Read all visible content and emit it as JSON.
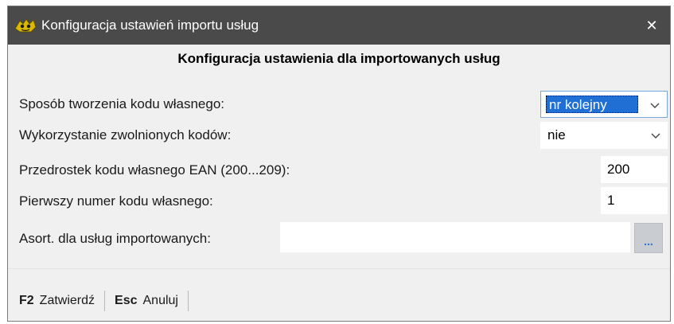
{
  "window": {
    "title": "Konfiguracja ustawień importu usług",
    "close_glyph": "✕"
  },
  "header": "Konfiguracja ustawienia dla importowanych usług",
  "rows": {
    "code_method": {
      "label": "Sposób tworzenia kodu własnego:",
      "value": "nr kolejny"
    },
    "reuse_codes": {
      "label": "Wykorzystanie zwolnionych kodów:",
      "value": "nie"
    },
    "ean_prefix": {
      "label": "Przedrostek kodu własnego EAN (200...209):",
      "value": "200"
    },
    "first_number": {
      "label": "Pierwszy numer kodu własnego:",
      "value": "1"
    },
    "assortment": {
      "label": "Asort. dla usług importowanych:",
      "value": "",
      "browse_label": "..."
    }
  },
  "footer": {
    "confirm": {
      "key": "F2",
      "label": "Zatwierdź"
    },
    "cancel": {
      "key": "Esc",
      "label": "Anuluj"
    }
  },
  "colors": {
    "titlebar": "#4a4a4a",
    "selection": "#1f6fd4",
    "browse_dots": "#2b6fd6"
  },
  "icons": {
    "app": "app-icon",
    "close": "close-icon",
    "dropdown": "chevron-down-icon"
  }
}
